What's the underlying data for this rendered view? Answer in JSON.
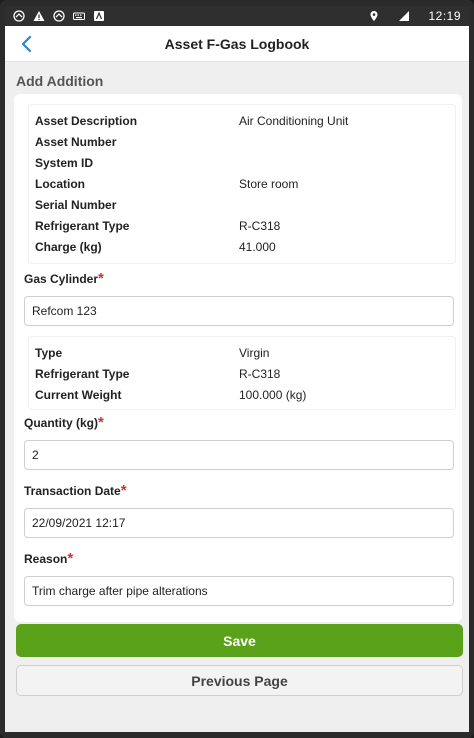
{
  "status_bar": {
    "time": "12:19",
    "icons": [
      "sync-icon",
      "warning-icon",
      "sync-icon",
      "keyboard-icon",
      "app-icon",
      "location-icon",
      "signal-icon"
    ]
  },
  "header": {
    "title": "Asset F-Gas Logbook",
    "back_icon": "chevron-left-icon"
  },
  "section_title": "Add Addition",
  "asset_info": [
    {
      "label": "Asset Description",
      "value": "Air Conditioning Unit"
    },
    {
      "label": "Asset Number",
      "value": ""
    },
    {
      "label": "System ID",
      "value": ""
    },
    {
      "label": "Location",
      "value": "Store room"
    },
    {
      "label": "Serial Number",
      "value": ""
    },
    {
      "label": "Refrigerant Type",
      "value": "R-C318"
    },
    {
      "label": "Charge (kg)",
      "value": "41.000"
    }
  ],
  "gas_cylinder": {
    "label": "Gas Cylinder",
    "value": "Refcom 123"
  },
  "cylinder_info": [
    {
      "label": "Type",
      "value": "Virgin"
    },
    {
      "label": "Refrigerant Type",
      "value": "R-C318"
    },
    {
      "label": "Current Weight",
      "value": "100.000 (kg)"
    }
  ],
  "quantity": {
    "label": "Quantity (kg)",
    "value": "2"
  },
  "transaction_date": {
    "label": "Transaction Date",
    "value": "22/09/2021 12:17"
  },
  "reason": {
    "label": "Reason",
    "value": "Trim charge after pipe alterations"
  },
  "required_mark": "*",
  "buttons": {
    "save": "Save",
    "previous": "Previous Page"
  },
  "colors": {
    "accent": "#5aa21a",
    "required": "#d32f2f",
    "back_icon": "#2a86c9"
  }
}
